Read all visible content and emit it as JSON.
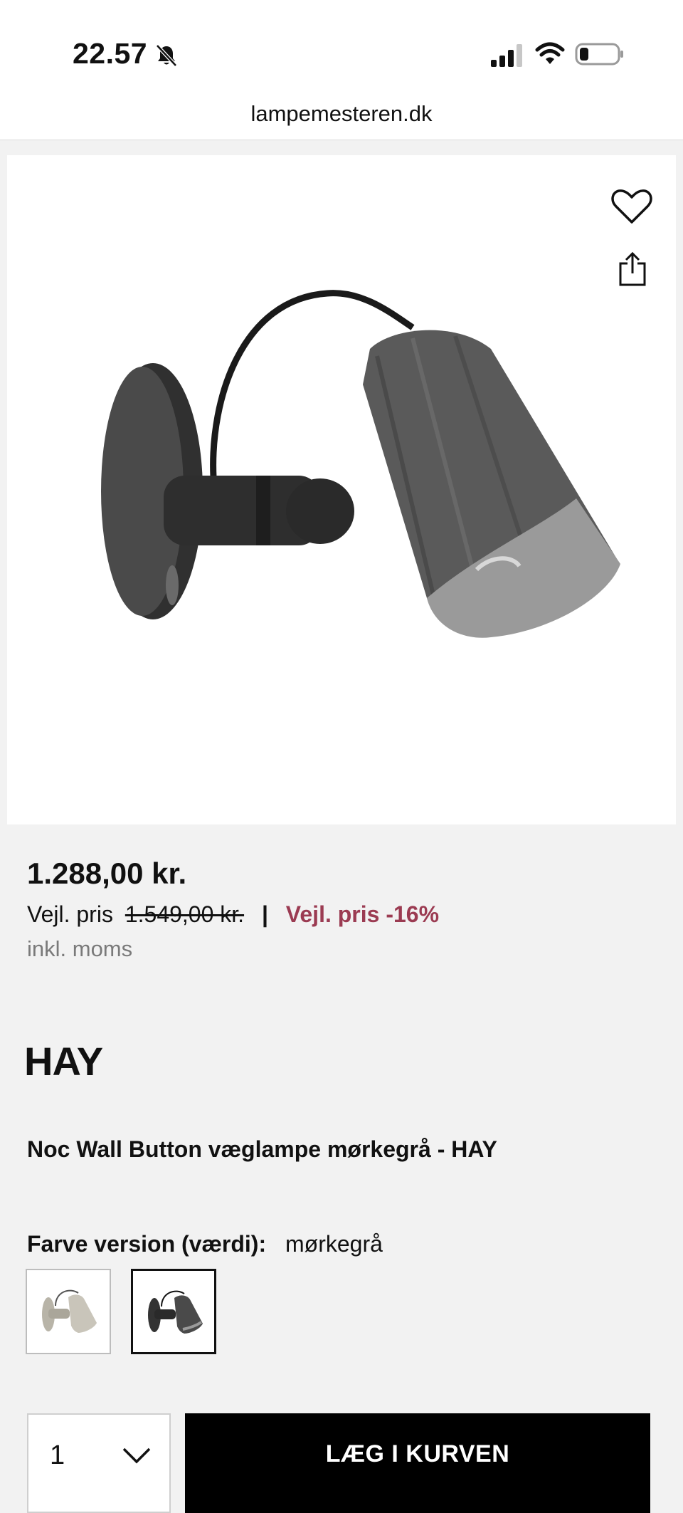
{
  "status_bar": {
    "time": "22.57",
    "icons": [
      "bell-slash-icon",
      "signal-icon",
      "wifi-icon",
      "battery-icon"
    ]
  },
  "browser": {
    "url": "lampemesteren.dk"
  },
  "product": {
    "price": "1.288,00 kr.",
    "rrp_label": "Vejl. pris",
    "rrp_old_price": "1.549,00 kr.",
    "separator": "|",
    "discount_label": "Vejl. pris -16%",
    "vat_note": "inkl. moms",
    "brand": "HAY",
    "title": "Noc Wall Button væglampe mørkegrå - HAY",
    "variant_label": "Farve version (værdi):",
    "variant_value": "mørkegrå",
    "swatches": [
      {
        "color": "#c9c5ba",
        "selected": false
      },
      {
        "color": "#3c3c3c",
        "selected": true
      }
    ]
  },
  "cart": {
    "quantity": "1",
    "add_button_label": "LÆG I KURVEN"
  },
  "colors": {
    "discount": "#9b3b52",
    "primary_button": "#000000"
  }
}
